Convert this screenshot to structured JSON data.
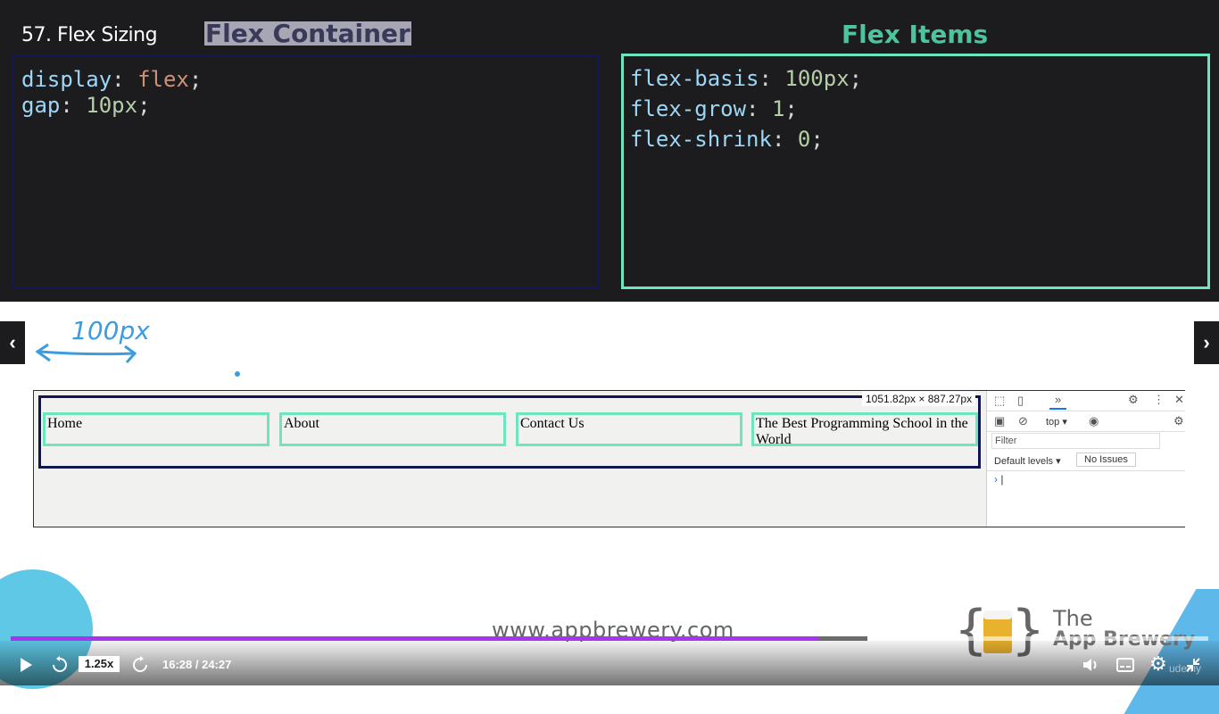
{
  "slide": {
    "lesson_title": "57. Flex Sizing",
    "flex_container_title": "Flex Container",
    "flex_items_title": "Flex Items",
    "container_code": [
      {
        "prop": "display",
        "sep": ": ",
        "value": "flex",
        "end": ";"
      },
      {
        "prop": "gap",
        "sep": ": ",
        "value": "10px",
        "end": ";"
      }
    ],
    "items_code": [
      {
        "prop": "flex-basis",
        "sep": ": ",
        "value": "100px",
        "end": ";"
      },
      {
        "prop": "flex-grow",
        "sep": ": ",
        "value": "1",
        "end": ";"
      },
      {
        "prop": "flex-shrink",
        "sep": ": ",
        "value": "0",
        "end": ";"
      }
    ],
    "annotation": "100px",
    "website": "www.appbrewery.com",
    "logo_line1": "The",
    "logo_line2": "App Brewery",
    "colors": {
      "accent_teal": "#6de6c0",
      "container_navy": "#141856",
      "progress_purple": "#a435f0"
    }
  },
  "browser": {
    "size_readout": "1051.82px × 887.27px",
    "nav_items": [
      "Home",
      "About",
      "Contact Us",
      "The Best Programming School in the World"
    ],
    "devtools": {
      "overflow_label": "»",
      "context": "top ▾",
      "filter_placeholder": "Filter",
      "levels": "Default levels ▾",
      "issues": "No Issues",
      "prompt": "›"
    }
  },
  "player": {
    "speed": "1.25x",
    "time": "16:28 / 24:27",
    "progress": 0.674,
    "watermark": "udemy"
  }
}
